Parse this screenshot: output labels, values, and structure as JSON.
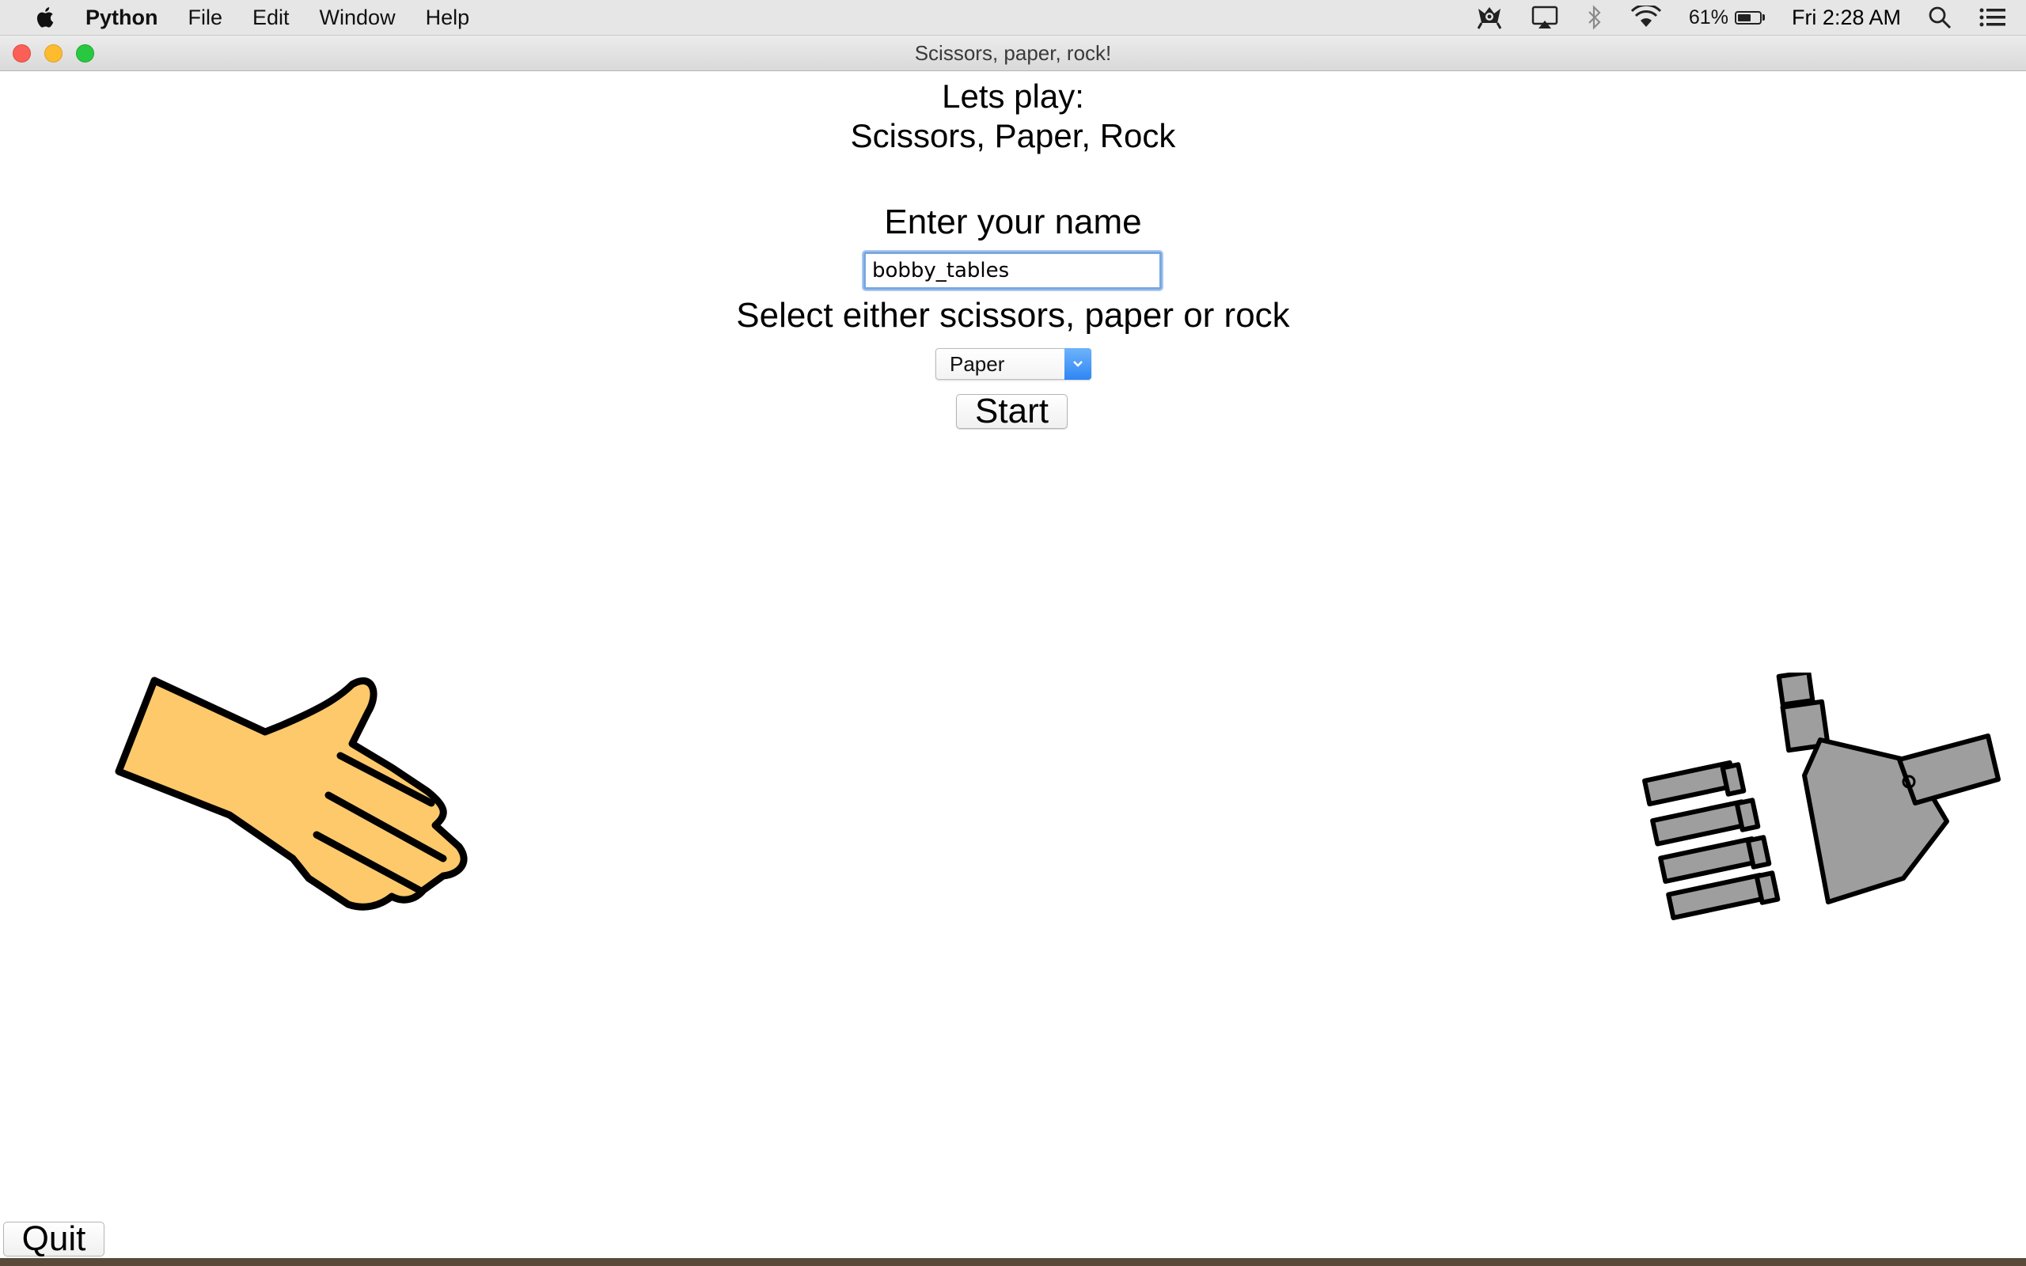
{
  "menubar": {
    "app_name": "Python",
    "items": [
      "File",
      "Edit",
      "Window",
      "Help"
    ],
    "battery_percent": "61%",
    "battery_level": 0.61,
    "clock": "Fri 2:28 AM"
  },
  "window": {
    "title": "Scissors, paper, rock!"
  },
  "main": {
    "heading_line1": "Lets play:",
    "heading_line2": "Scissors, Paper, Rock",
    "name_label": "Enter your name",
    "name_value": "bobby_tables",
    "choice_label": "Select either scissors, paper or rock",
    "choice_selected": "Paper",
    "start_label": "Start",
    "quit_label": "Quit"
  },
  "colors": {
    "human_hand": "#fdc96b",
    "robot_hand": "#9e9e9e",
    "select_accent": "#2f86f4"
  },
  "icons": [
    "apple-icon",
    "app-status-icon",
    "airplay-icon",
    "bluetooth-icon",
    "wifi-icon",
    "battery-icon",
    "spotlight-search-icon",
    "notification-center-icon",
    "chevron-down-icon"
  ]
}
